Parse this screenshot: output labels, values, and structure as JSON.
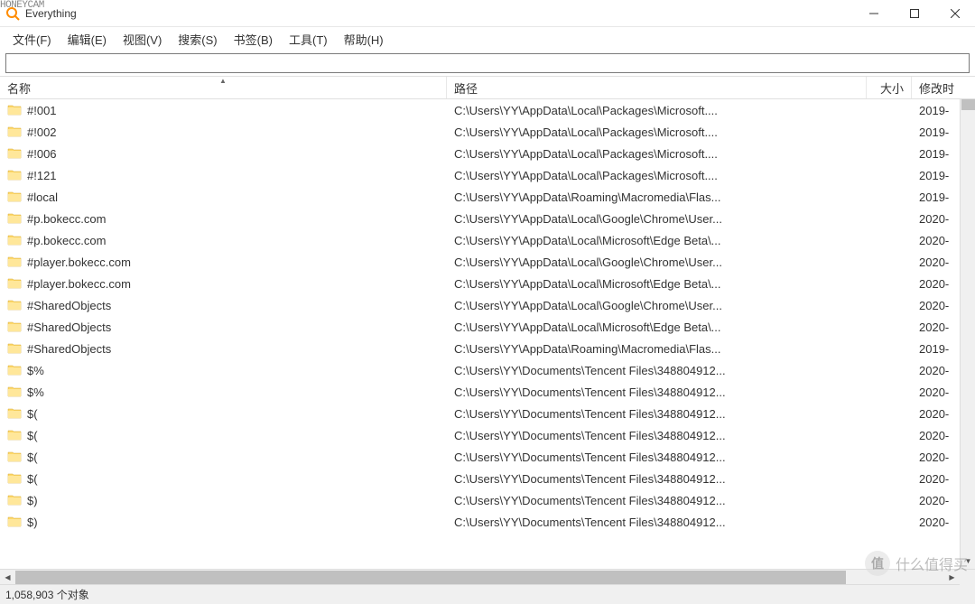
{
  "watermark_tl": "HONEYCAM",
  "window": {
    "title": "Everything"
  },
  "menu": {
    "file": "文件(F)",
    "edit": "编辑(E)",
    "view": "视图(V)",
    "search": "搜索(S)",
    "bookmarks": "书签(B)",
    "tools": "工具(T)",
    "help": "帮助(H)"
  },
  "search_value": "",
  "columns": {
    "name": "名称",
    "path": "路径",
    "size": "大小",
    "modified": "修改时"
  },
  "rows": [
    {
      "name": "#!001",
      "path": "C:\\Users\\YY\\AppData\\Local\\Packages\\Microsoft....",
      "size": "",
      "mod": "2019-"
    },
    {
      "name": "#!002",
      "path": "C:\\Users\\YY\\AppData\\Local\\Packages\\Microsoft....",
      "size": "",
      "mod": "2019-"
    },
    {
      "name": "#!006",
      "path": "C:\\Users\\YY\\AppData\\Local\\Packages\\Microsoft....",
      "size": "",
      "mod": "2019-"
    },
    {
      "name": "#!121",
      "path": "C:\\Users\\YY\\AppData\\Local\\Packages\\Microsoft....",
      "size": "",
      "mod": "2019-"
    },
    {
      "name": "#local",
      "path": "C:\\Users\\YY\\AppData\\Roaming\\Macromedia\\Flas...",
      "size": "",
      "mod": "2019-"
    },
    {
      "name": "#p.bokecc.com",
      "path": "C:\\Users\\YY\\AppData\\Local\\Google\\Chrome\\User...",
      "size": "",
      "mod": "2020-"
    },
    {
      "name": "#p.bokecc.com",
      "path": "C:\\Users\\YY\\AppData\\Local\\Microsoft\\Edge Beta\\...",
      "size": "",
      "mod": "2020-"
    },
    {
      "name": "#player.bokecc.com",
      "path": "C:\\Users\\YY\\AppData\\Local\\Google\\Chrome\\User...",
      "size": "",
      "mod": "2020-"
    },
    {
      "name": "#player.bokecc.com",
      "path": "C:\\Users\\YY\\AppData\\Local\\Microsoft\\Edge Beta\\...",
      "size": "",
      "mod": "2020-"
    },
    {
      "name": "#SharedObjects",
      "path": "C:\\Users\\YY\\AppData\\Local\\Google\\Chrome\\User...",
      "size": "",
      "mod": "2020-"
    },
    {
      "name": "#SharedObjects",
      "path": "C:\\Users\\YY\\AppData\\Local\\Microsoft\\Edge Beta\\...",
      "size": "",
      "mod": "2020-"
    },
    {
      "name": "#SharedObjects",
      "path": "C:\\Users\\YY\\AppData\\Roaming\\Macromedia\\Flas...",
      "size": "",
      "mod": "2019-"
    },
    {
      "name": "$%",
      "path": "C:\\Users\\YY\\Documents\\Tencent Files\\348804912...",
      "size": "",
      "mod": "2020-"
    },
    {
      "name": "$%",
      "path": "C:\\Users\\YY\\Documents\\Tencent Files\\348804912...",
      "size": "",
      "mod": "2020-"
    },
    {
      "name": "$(",
      "path": "C:\\Users\\YY\\Documents\\Tencent Files\\348804912...",
      "size": "",
      "mod": "2020-"
    },
    {
      "name": "$(",
      "path": "C:\\Users\\YY\\Documents\\Tencent Files\\348804912...",
      "size": "",
      "mod": "2020-"
    },
    {
      "name": "$(",
      "path": "C:\\Users\\YY\\Documents\\Tencent Files\\348804912...",
      "size": "",
      "mod": "2020-"
    },
    {
      "name": "$(",
      "path": "C:\\Users\\YY\\Documents\\Tencent Files\\348804912...",
      "size": "",
      "mod": "2020-"
    },
    {
      "name": "$)",
      "path": "C:\\Users\\YY\\Documents\\Tencent Files\\348804912...",
      "size": "",
      "mod": "2020-"
    },
    {
      "name": "$)",
      "path": "C:\\Users\\YY\\Documents\\Tencent Files\\348804912...",
      "size": "",
      "mod": "2020-"
    }
  ],
  "status": "1,058,903 个对象",
  "watermark_br": {
    "badge": "值",
    "text": "什么值得买"
  }
}
